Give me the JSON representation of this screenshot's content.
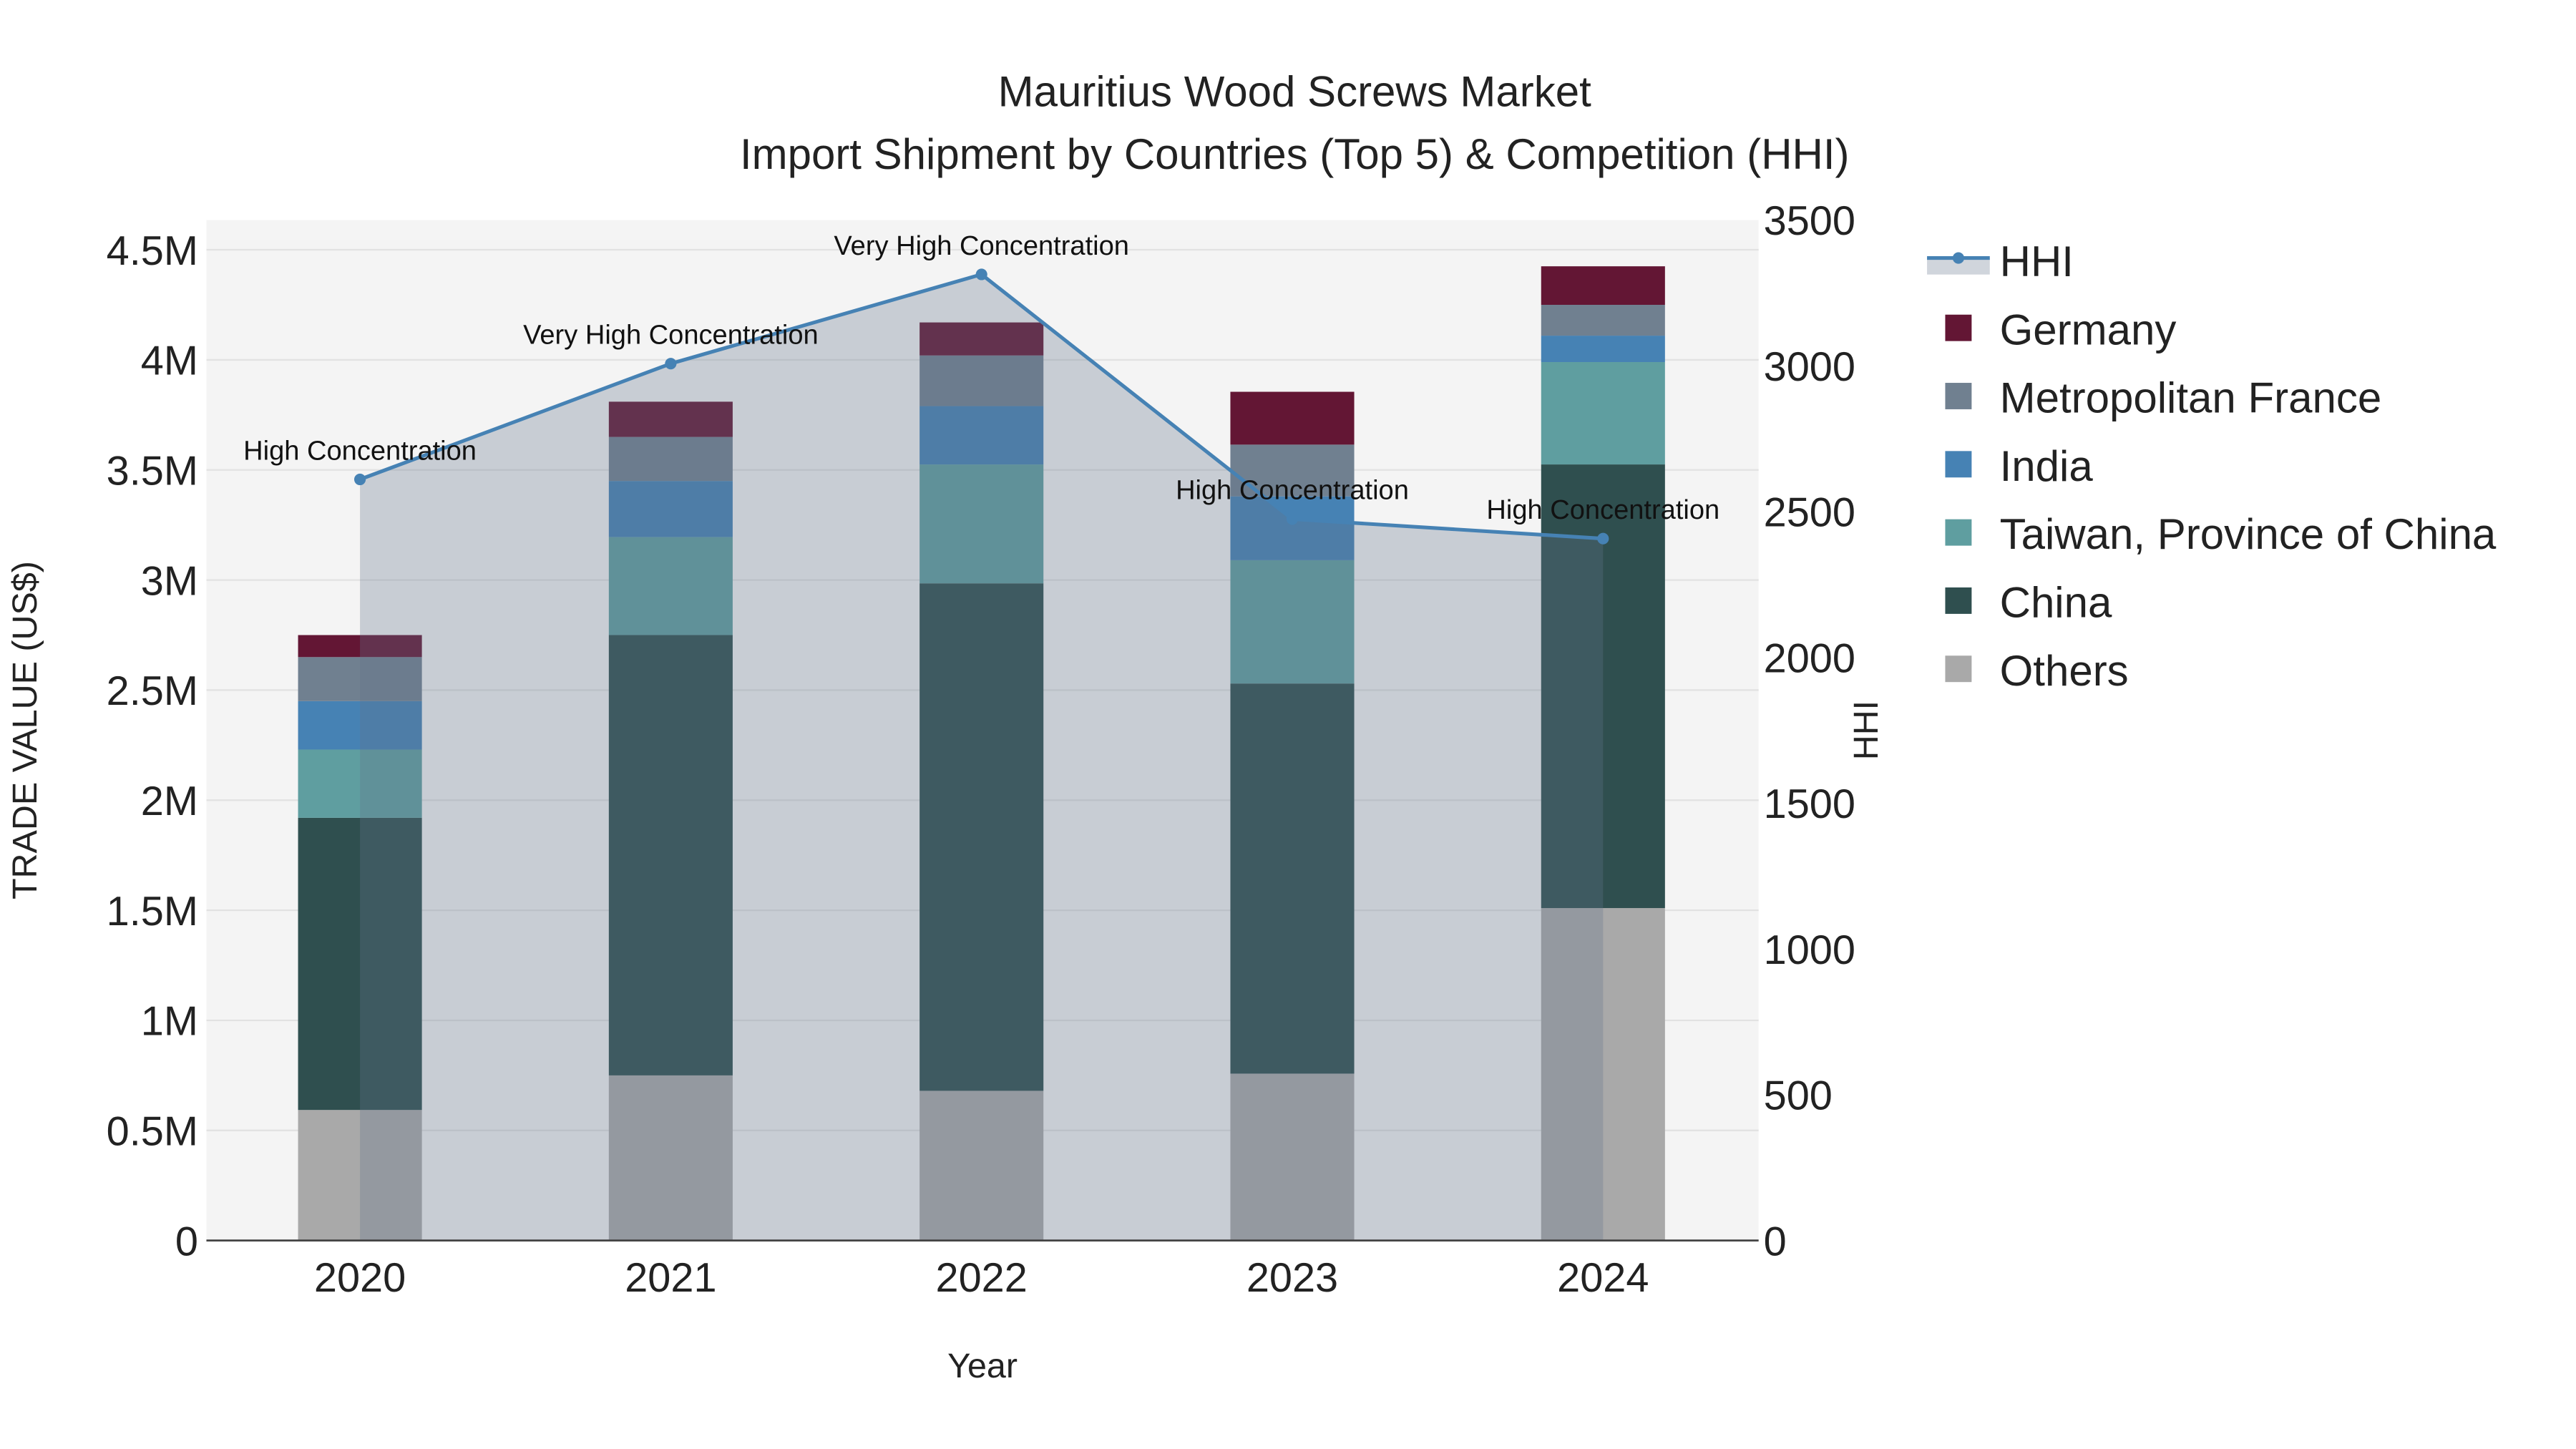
{
  "chart_data": {
    "type": "bar",
    "title": "Mauritius Wood Screws Market",
    "subtitle": "Import Shipment by Countries (Top 5) & Competition (HHI)",
    "xlabel": "Year",
    "ylabel": "TRADE VALUE (US$)",
    "y2label": "HHI",
    "categories": [
      "2020",
      "2021",
      "2022",
      "2023",
      "2024"
    ],
    "ylim": [
      0,
      4600000
    ],
    "y2lim": [
      0,
      3570
    ],
    "yticks": [
      0,
      500000,
      1000000,
      1500000,
      2000000,
      2500000,
      3000000,
      3500000,
      4000000,
      4500000
    ],
    "ytick_labels": [
      "0",
      "0.5M",
      "1M",
      "1.5M",
      "2M",
      "2.5M",
      "3M",
      "3.5M",
      "4M",
      "4.5M"
    ],
    "y2ticks": [
      0,
      500,
      1000,
      1500,
      2000,
      2500,
      3000,
      3500
    ],
    "y2tick_labels": [
      "0",
      "500",
      "1000",
      "1500",
      "2000",
      "2500",
      "3000",
      "3500"
    ],
    "series": [
      {
        "name": "Others",
        "color": "#a9a9a9",
        "values": [
          593000,
          750000,
          680000,
          758000,
          1510000
        ]
      },
      {
        "name": "China",
        "color": "#2f4f4f",
        "values": [
          1327000,
          2000000,
          2305000,
          1772000,
          2015000
        ]
      },
      {
        "name": "Taiwan, Province of China",
        "color": "#5f9ea0",
        "values": [
          310000,
          445000,
          540000,
          560000,
          465000
        ]
      },
      {
        "name": "India",
        "color": "#4682b4",
        "values": [
          220000,
          255000,
          265000,
          290000,
          120000
        ]
      },
      {
        "name": "Metropolitan France",
        "color": "#708090",
        "values": [
          200000,
          200000,
          230000,
          235000,
          140000
        ]
      },
      {
        "name": "Germany",
        "color": "#631634",
        "values": [
          100000,
          160000,
          150000,
          240000,
          175000
        ]
      }
    ],
    "hhi": {
      "name": "HHI",
      "color": "#4682b4",
      "values": [
        2610,
        3007,
        3313,
        2474,
        2407
      ],
      "annotations": [
        "High Concentration",
        "Very High Concentration",
        "Very High Concentration",
        "High Concentration",
        "High Concentration"
      ]
    },
    "legend_position": "right",
    "legend_order": [
      "HHI",
      "Germany",
      "Metropolitan France",
      "India",
      "Taiwan, Province of China",
      "China",
      "Others"
    ],
    "grid": true
  }
}
